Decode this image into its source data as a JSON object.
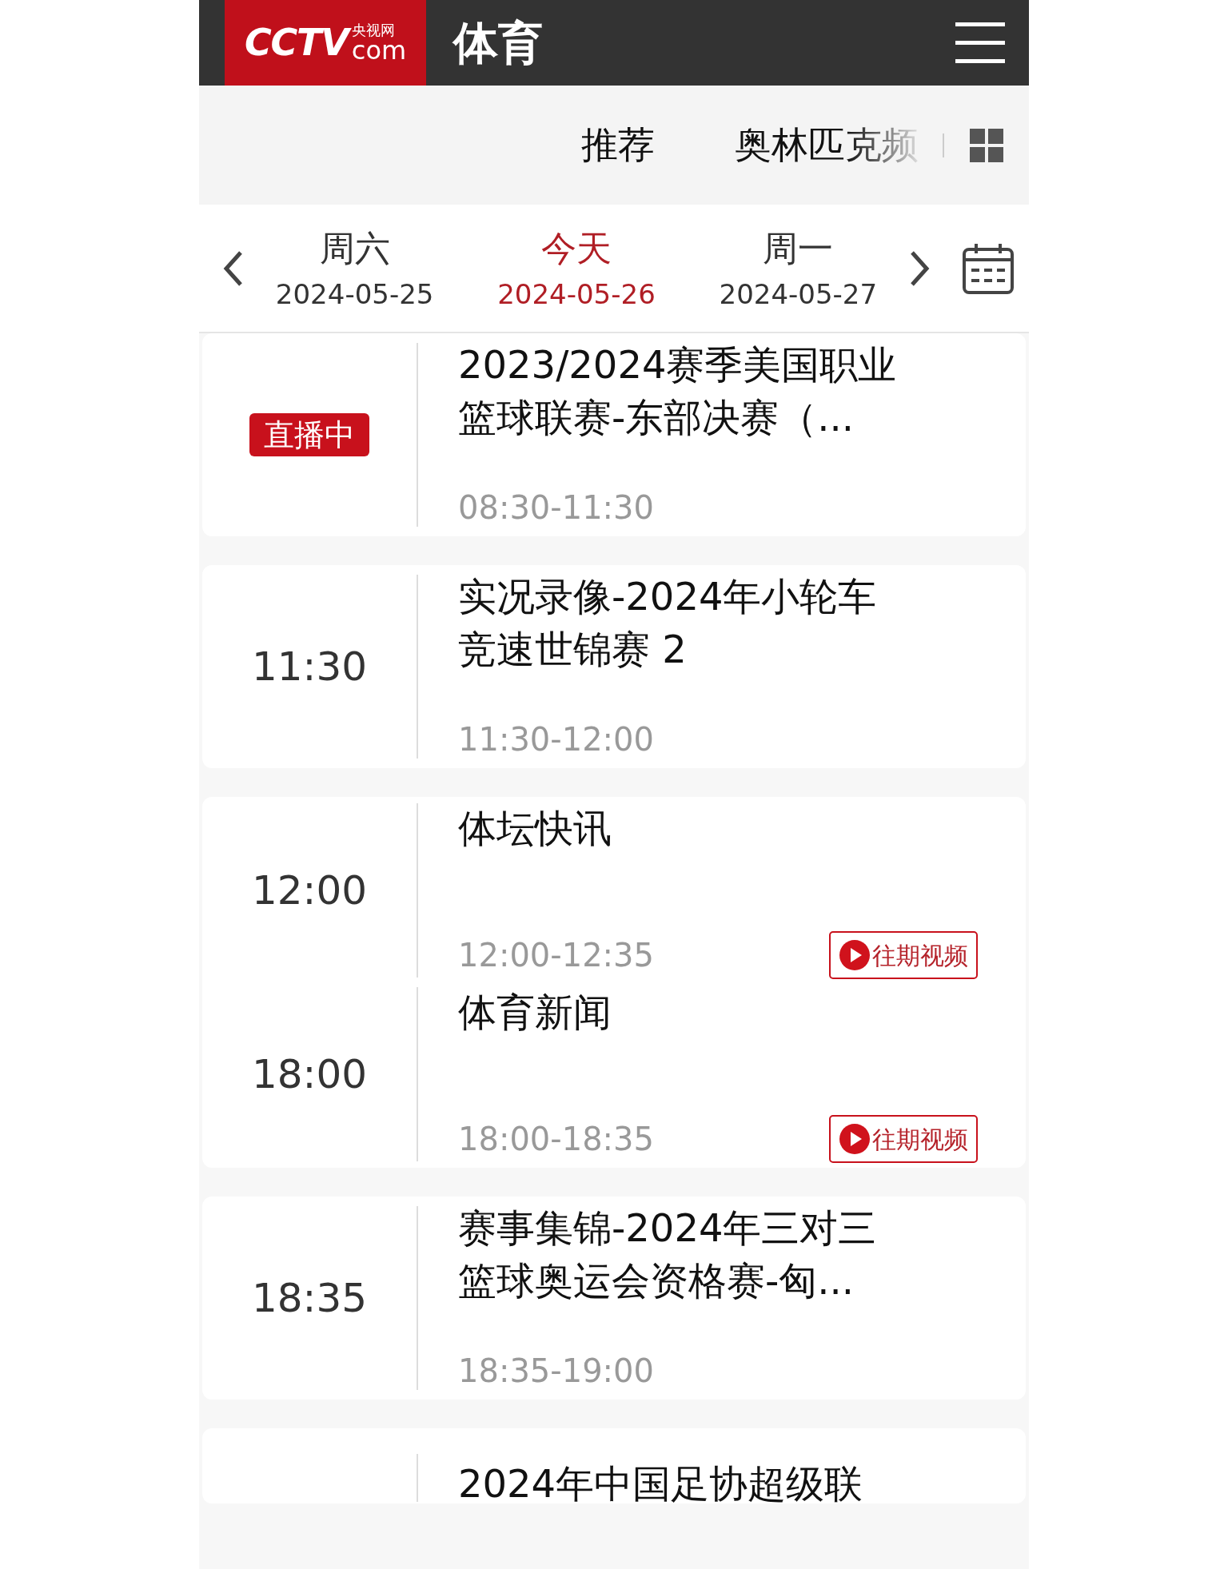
{
  "header": {
    "logo": {
      "mark": "CCTV",
      "cn": "央视网",
      "domain": "com"
    },
    "title": "体育"
  },
  "channel_tabs": [
    {
      "label": "推荐",
      "faded": false
    },
    {
      "label": "奥林匹克频",
      "faded": true
    }
  ],
  "dates": [
    {
      "weekday": "周六",
      "date": "2024-05-25",
      "selected": false
    },
    {
      "weekday": "今天",
      "date": "2024-05-26",
      "selected": true
    },
    {
      "weekday": "周一",
      "date": "2024-05-27",
      "selected": false
    }
  ],
  "cards": [
    {
      "programs": [
        {
          "kind": "live",
          "badge": "直播中",
          "title_lines": [
            "2023/2024赛季美国职业",
            "篮球联赛-东部决赛（..."
          ],
          "range": "08:30-11:30"
        }
      ]
    },
    {
      "programs": [
        {
          "kind": "time",
          "start": "11:30",
          "title_lines": [
            "实况录像-2024年小轮车",
            "竞速世锦赛 2"
          ],
          "range": "11:30-12:00"
        }
      ]
    },
    {
      "programs": [
        {
          "kind": "time",
          "start": "12:00",
          "title_lines": [
            "体坛快讯"
          ],
          "range": "12:00-12:35",
          "replay": "往期视频"
        },
        {
          "kind": "time",
          "start": "18:00",
          "title_lines": [
            "体育新闻"
          ],
          "range": "18:00-18:35",
          "replay": "往期视频"
        }
      ]
    },
    {
      "programs": [
        {
          "kind": "time",
          "start": "18:35",
          "title_lines": [
            "赛事集锦-2024年三对三",
            "篮球奥运会资格赛-匈..."
          ],
          "range": "18:35-19:00"
        }
      ]
    },
    {
      "programs": [
        {
          "kind": "partial",
          "title_lines": [
            "2024年中国足协超级联"
          ]
        }
      ]
    }
  ]
}
